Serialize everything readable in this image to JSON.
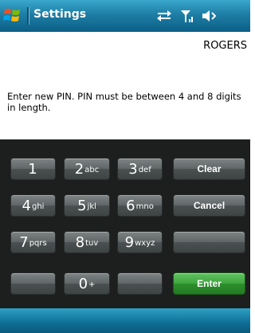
{
  "titlebar": {
    "app_title": "Settings",
    "icons": [
      "start-logo-icon",
      "connectivity-icon",
      "signal-icon",
      "volume-icon"
    ]
  },
  "carrier": "ROGERS",
  "message": "Enter new PIN. PIN must be between 4 and 8 digits in length.",
  "keypad": {
    "keys": [
      {
        "digit": "1",
        "letters": ""
      },
      {
        "digit": "2",
        "letters": "abc"
      },
      {
        "digit": "3",
        "letters": "def"
      },
      {
        "digit": "4",
        "letters": "ghi"
      },
      {
        "digit": "5",
        "letters": "jkl"
      },
      {
        "digit": "6",
        "letters": "mno"
      },
      {
        "digit": "7",
        "letters": "pqrs"
      },
      {
        "digit": "8",
        "letters": "tuv"
      },
      {
        "digit": "9",
        "letters": "wxyz"
      },
      {
        "digit": "0",
        "letters": "+"
      }
    ],
    "clear_label": "Clear",
    "cancel_label": "Cancel",
    "enter_label": "Enter"
  },
  "colors": {
    "titlebar": "#1e7ea5",
    "keypad_bg": "#1d1f1e",
    "key": "#5f6566",
    "enter_key": "#3fa43f"
  }
}
